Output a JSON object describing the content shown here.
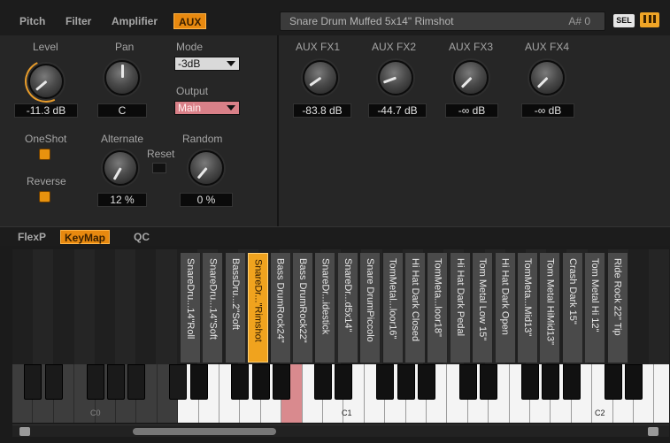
{
  "tabs": [
    {
      "label": "Pitch",
      "active": false
    },
    {
      "label": "Filter",
      "active": false
    },
    {
      "label": "Amplifier",
      "active": false
    },
    {
      "label": "AUX",
      "active": true
    }
  ],
  "title": {
    "name": "Snare Drum Muffed 5x14\" Rimshot",
    "note": "A# 0"
  },
  "sel_label": "SEL",
  "midi_icon": "midi-icon",
  "amp": {
    "level": {
      "label": "Level",
      "value": "-11.3 dB"
    },
    "pan": {
      "label": "Pan",
      "value": "C"
    },
    "mode": {
      "label": "Mode",
      "value": "-3dB"
    },
    "output": {
      "label": "Output",
      "value": "Main"
    },
    "oneshot": {
      "label": "OneShot"
    },
    "reverse": {
      "label": "Reverse"
    },
    "alternate": {
      "label": "Alternate",
      "value": "12 %"
    },
    "reset": {
      "label": "Reset"
    },
    "random": {
      "label": "Random",
      "value": "0 %"
    }
  },
  "aux": [
    {
      "label": "AUX FX1",
      "value": "-83.8 dB"
    },
    {
      "label": "AUX FX2",
      "value": "-44.7 dB"
    },
    {
      "label": "AUX FX3",
      "value": "-∞ dB"
    },
    {
      "label": "AUX FX4",
      "value": "-∞ dB"
    }
  ],
  "subtabs": [
    {
      "label": "FlexP",
      "active": false
    },
    {
      "label": "KeyMap",
      "active": true
    },
    {
      "label": "QC",
      "active": false
    }
  ],
  "samples": [
    "SnareDru...14\"Roll",
    "SnareDru...14\"Soft",
    "BassDru...2\"Soft",
    "SnareDr...\"Rimshot",
    "Bass DrumRock24\"",
    "Bass DrumRock22\"",
    "SnareDr...idestick",
    "SnareDr...d5x14\"",
    "Snare DrumPiccolo",
    "TomMetal...loor16\"",
    "Hi Hat Dark Closed",
    "TomMeta...loor18\"",
    "Hi Hat Dark Pedal",
    "Tom Metal Low 15\"",
    "Hi Hat Dark Open",
    "TomMeta...Mid13\"",
    "Tom Metal HiMid13\"",
    "Crash Dark 15\"",
    "Tom Metal Hi 12\"",
    "Ride Rock 22\" Tip"
  ],
  "octave_labels": [
    "C0",
    "C1",
    "C2"
  ],
  "colors": {
    "accent": "#e8890f",
    "selected_key": "#d98a8e"
  }
}
